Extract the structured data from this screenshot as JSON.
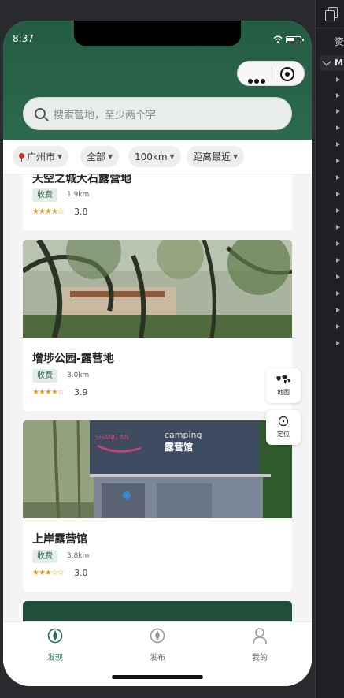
{
  "status_bar": {
    "time": "8:37"
  },
  "search": {
    "placeholder": "搜索营地，至少两个字"
  },
  "filters": [
    {
      "label": "广州市"
    },
    {
      "label": "全部"
    },
    {
      "label": "100km"
    },
    {
      "label": "距离最近"
    }
  ],
  "cards": [
    {
      "title": "天空之城大石露营地",
      "tag": "收费",
      "distance": "1.9km",
      "stars": "★★★★☆",
      "score": "3.8"
    },
    {
      "title": "增埗公园-露营地",
      "tag": "收费",
      "distance": "3.0km",
      "stars": "★★★★☆",
      "score": "3.9"
    },
    {
      "title": "上岸露营馆",
      "tag": "收费",
      "distance": "3.8km",
      "stars": "★★★☆☆",
      "score": "3.0"
    }
  ],
  "photo_signs": {
    "brand": "SHANG AN",
    "camping": "camping",
    "store_name": "露营馆"
  },
  "fabs": [
    {
      "label": "地图"
    },
    {
      "label": "定位"
    }
  ],
  "tabs": [
    {
      "label": "发现"
    },
    {
      "label": "发布"
    },
    {
      "label": "我的"
    }
  ],
  "devtools": {
    "panel_label": "资",
    "section_label": "MI"
  },
  "colors": {
    "brand_green": "#245c44",
    "star": "#e1a22b"
  }
}
